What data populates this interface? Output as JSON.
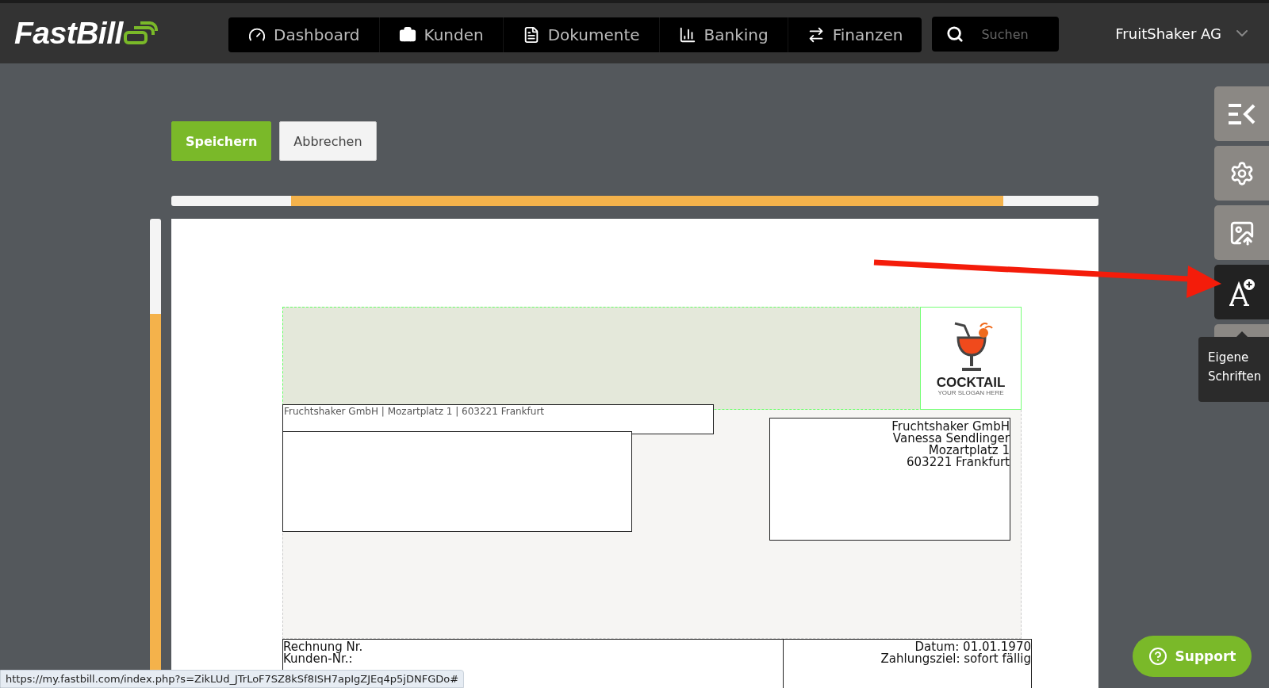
{
  "header": {
    "logo": "FastBill",
    "nav": [
      {
        "label": "Dashboard"
      },
      {
        "label": "Kunden"
      },
      {
        "label": "Dokumente"
      },
      {
        "label": "Banking"
      },
      {
        "label": "Finanzen"
      }
    ],
    "search": {
      "placeholder": "Suchen"
    },
    "account": "FruitShaker AG"
  },
  "toolbar": {
    "buttons": [
      {
        "label": "Speichern",
        "kind": "primary"
      },
      {
        "label": "Abbrechen",
        "kind": "secondary"
      }
    ]
  },
  "document": {
    "logo": {
      "name": "COCKTAIL",
      "slogan": "YOUR SLOGAN HERE"
    },
    "sender_line": "Fruchtshaker GmbH | Mozartplatz 1 | 603221 Frankfurt",
    "recipient": [
      "Fruchtshaker GmbH",
      "Vanessa Sendlinger",
      "Mozartplatz 1",
      "603221 Frankfurt"
    ],
    "meta_left": [
      "Rechnung Nr.",
      "Kunden-Nr.:"
    ],
    "meta_right": [
      "Datum: 01.01.1970",
      "Zahlungsziel: sofort fällig"
    ]
  },
  "sidebar": {
    "tools": [
      {
        "selected": false
      },
      {
        "selected": false
      },
      {
        "selected": false
      },
      {
        "selected": true
      },
      {
        "selected": false
      }
    ],
    "tooltip": [
      "Eigene",
      "Schriften"
    ]
  },
  "support": "Support",
  "status_url": "https://my.fastbill.com/index.php?s=ZikLUd_JTrLoF7SZ8kSf8ISH7apIgZJEq4p5jDNFGDo#"
}
